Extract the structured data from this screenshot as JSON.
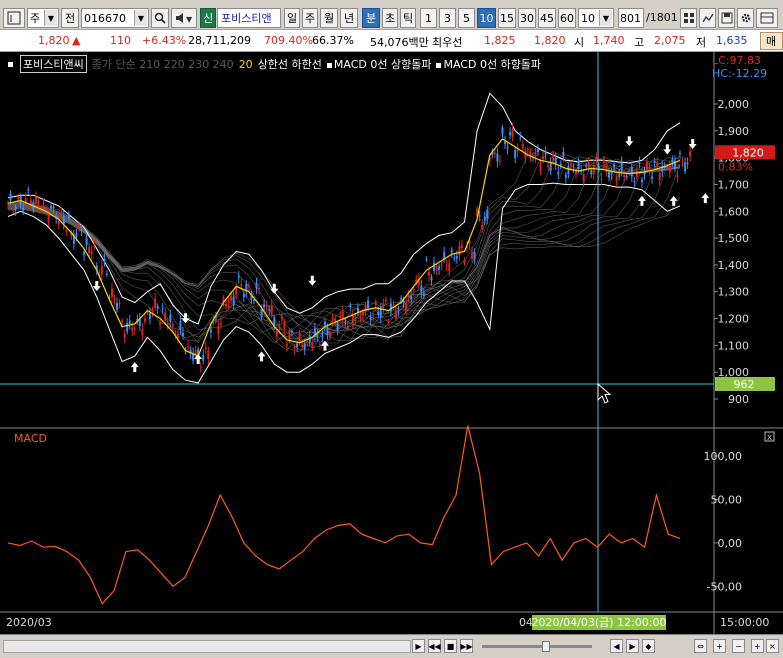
{
  "toolbar": {
    "period_label": "주",
    "market_label": "전",
    "code_value": "016670",
    "type_badge": "신",
    "stock_name": "포비스티앤",
    "periods": [
      "일",
      "주",
      "월",
      "년",
      "분",
      "초",
      "틱"
    ],
    "active_period": "분",
    "intervals": [
      "1",
      "3",
      "5",
      "10",
      "15",
      "30",
      "45",
      "60"
    ],
    "active_interval": "10",
    "count_value": "10",
    "page_value": "801",
    "page_total": "/1801"
  },
  "quote": {
    "price": "1,820",
    "change": "110",
    "change_pct": "+6.43%",
    "volume": "28,711,209",
    "volume_ratio": "709.40%",
    "turnover": "66.37%",
    "amount": "54,076백만",
    "best_ask_label": "최우선",
    "best_ask": "1,825",
    "best_bid": "1,820",
    "open_label": "시",
    "open": "1,740",
    "high_label": "고",
    "high": "2,075",
    "low_label": "저",
    "low": "1,635",
    "end_label": "매"
  },
  "legend": {
    "name": "포비스티앤씨",
    "ma_items": "종가 단순 210 220 230 240",
    "ma_last": "20",
    "band_label": "상한선 하한선",
    "macd_up": "MACD 0선 상향돌파",
    "macd_down": "MACD 0선 하향돌파"
  },
  "price_axis": {
    "lc": "LC:97.83",
    "hc": "HC:-12.29",
    "current_price": "1,820",
    "current_pct": "0.83%",
    "cursor_value": "962"
  },
  "macd_panel": {
    "title": "MACD",
    "close_glyph": "x"
  },
  "time_axis": {
    "left_label": "2020/03",
    "mid_label": "04",
    "cursor_label": "2020/04/03(금) 12:00:00",
    "right_label": "15:00:00"
  },
  "colors": {
    "up": "#e0241c",
    "down": "#3a8fff",
    "ma20": "#ffd400",
    "band": "#ffffff",
    "macd": "#ff5a1e",
    "cursor": "#2fc8e6",
    "cursor_box": "#8cc63f"
  },
  "chart_data": [
    {
      "type": "candlestick",
      "title": "포비스티앤씨",
      "ylim": [
        900,
        2000
      ],
      "yticks": [
        900,
        1000,
        1100,
        1200,
        1300,
        1400,
        1500,
        1600,
        1700,
        1800,
        1900,
        2000
      ],
      "ytick_labels": [
        "900",
        "1,000",
        "1,100",
        "1,200",
        "1,300",
        "1,400",
        "1,500",
        "1,600",
        "1,700",
        "1,800",
        "1,900",
        "2,000"
      ],
      "x_labels": [
        "2020/03",
        "04"
      ],
      "series": [
        {
          "name": "20",
          "values": [
            1630,
            1640,
            1620,
            1600,
            1570,
            1520,
            1460,
            1380,
            1270,
            1170,
            1180,
            1230,
            1200,
            1150,
            1080,
            1060,
            1180,
            1260,
            1320,
            1300,
            1240,
            1170,
            1120,
            1110,
            1130,
            1170,
            1190,
            1210,
            1230,
            1240,
            1230,
            1260,
            1320,
            1380,
            1410,
            1440,
            1450,
            1570,
            1810,
            1870,
            1840,
            1810,
            1790,
            1780,
            1760,
            1750,
            1760,
            1755,
            1745,
            1740,
            1745,
            1755,
            1770,
            1790
          ]
        }
      ],
      "band_upper": [
        1650,
        1660,
        1660,
        1640,
        1620,
        1580,
        1540,
        1460,
        1380,
        1280,
        1260,
        1300,
        1330,
        1250,
        1200,
        1180,
        1320,
        1400,
        1450,
        1440,
        1380,
        1300,
        1240,
        1220,
        1240,
        1280,
        1300,
        1310,
        1310,
        1330,
        1330,
        1370,
        1440,
        1480,
        1510,
        1520,
        1560,
        1900,
        2040,
        1990,
        1900,
        1860,
        1830,
        1810,
        1790,
        1785,
        1790,
        1790,
        1785,
        1780,
        1790,
        1830,
        1900,
        1930
      ],
      "band_lower": [
        1580,
        1600,
        1580,
        1550,
        1500,
        1440,
        1380,
        1280,
        1160,
        1040,
        1060,
        1130,
        1080,
        1010,
        970,
        960,
        1040,
        1120,
        1170,
        1150,
        1100,
        1030,
        1000,
        1000,
        1030,
        1070,
        1090,
        1110,
        1140,
        1140,
        1130,
        1150,
        1200,
        1260,
        1300,
        1340,
        1340,
        1260,
        1160,
        1610,
        1680,
        1700,
        1700,
        1705,
        1700,
        1700,
        1700,
        1700,
        1690,
        1690,
        1680,
        1640,
        1600,
        1620
      ],
      "buy_signals": [
        [
          20,
          1060
        ],
        [
          30,
          1090
        ],
        [
          40,
          1100
        ],
        [
          50,
          1140
        ],
        [
          100,
          1680
        ],
        [
          105,
          1680
        ],
        [
          110,
          1690
        ]
      ],
      "sell_signals": [
        [
          14,
          1280
        ],
        [
          28,
          1160
        ],
        [
          42,
          1270
        ],
        [
          48,
          1300
        ],
        [
          98,
          1820
        ],
        [
          104,
          1790
        ],
        [
          108,
          1810
        ]
      ]
    },
    {
      "type": "line",
      "title": "MACD",
      "ylim": [
        -75,
        130
      ],
      "yticks": [
        -50,
        0,
        50,
        100
      ],
      "ytick_labels": [
        "-50,00",
        "0,00",
        "50,00",
        "100,00"
      ],
      "series": [
        {
          "name": "MACD",
          "values": [
            0,
            -3,
            2,
            -5,
            -4,
            -10,
            -20,
            -40,
            -70,
            -55,
            -10,
            -8,
            -20,
            -35,
            -50,
            -40,
            -10,
            20,
            55,
            30,
            0,
            -15,
            -25,
            -30,
            -20,
            -10,
            5,
            15,
            20,
            22,
            10,
            5,
            0,
            8,
            10,
            0,
            -2,
            30,
            55,
            135,
            80,
            -25,
            -10,
            -5,
            0,
            -15,
            5,
            -20,
            0,
            5,
            -5,
            10,
            0,
            5,
            -5,
            55,
            10,
            5
          ]
        }
      ]
    }
  ]
}
